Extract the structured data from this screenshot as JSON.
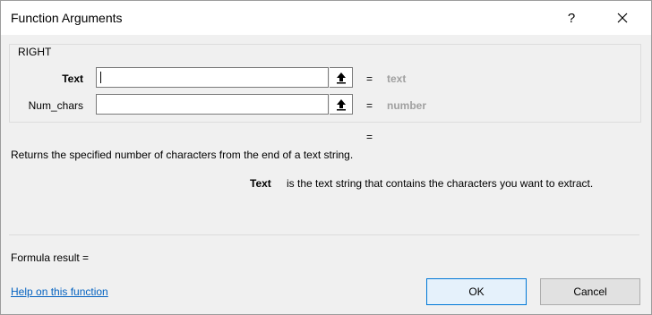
{
  "window": {
    "title": "Function Arguments",
    "help_glyph": "?",
    "close_icon": "close-icon"
  },
  "function": {
    "name": "RIGHT",
    "args": [
      {
        "label": "Text",
        "value": "",
        "equals": "=",
        "hint": "text"
      },
      {
        "label": "Num_chars",
        "value": "",
        "equals": "=",
        "hint": "number"
      }
    ],
    "result_equals": "=",
    "description": "Returns the specified number of characters from the end of a text string.",
    "arg_help_name": "Text",
    "arg_help_text": "is the text string that contains the characters you want to extract."
  },
  "formula_result": "Formula result =",
  "footer": {
    "help_link": "Help on this function",
    "ok_label": "OK",
    "cancel_label": "Cancel"
  },
  "colors": {
    "dialog_bg": "#f0f0f0",
    "link": "#0563c1",
    "ok_border": "#0078d7"
  }
}
